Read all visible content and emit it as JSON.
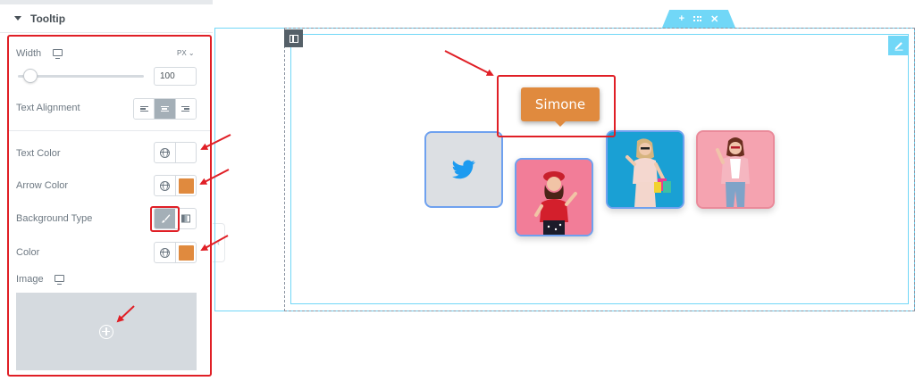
{
  "panel": {
    "section_title": "Tooltip",
    "width": {
      "label": "Width",
      "unit": "PX",
      "value": "100"
    },
    "text_alignment": {
      "label": "Text Alignment",
      "options": [
        "left",
        "center",
        "right"
      ],
      "selected": "center"
    },
    "text_color": {
      "label": "Text Color",
      "value": "#ffffff"
    },
    "arrow_color": {
      "label": "Arrow Color",
      "value": "#e08a3e"
    },
    "background_type": {
      "label": "Background Type",
      "options": [
        "classic",
        "gradient"
      ],
      "selected": "classic"
    },
    "color": {
      "label": "Color",
      "value": "#e08a3e"
    },
    "image": {
      "label": "Image"
    }
  },
  "canvas": {
    "tooltip_text": "Simone",
    "tooltip_color": "#e08a3e",
    "accent": "#71d7f7"
  },
  "annotation_color": "#e01f26"
}
